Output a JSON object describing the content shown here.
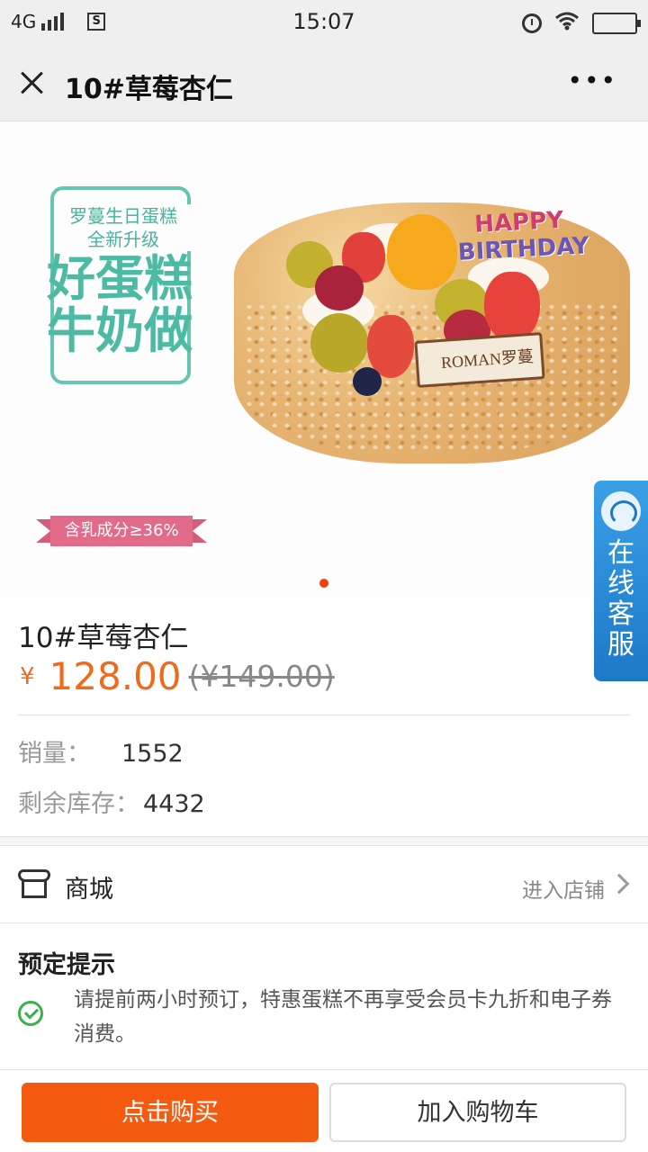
{
  "status_bar": {
    "network": "4G",
    "time": "15:07",
    "sim_icon": "sim-card-icon",
    "icons": [
      "signal-icon",
      "sim-card-icon",
      "alarm-icon",
      "wifi-icon",
      "battery-icon"
    ]
  },
  "nav": {
    "title": "10#草莓杏仁",
    "close_icon": "close-icon",
    "more_label": "•••"
  },
  "banner": {
    "promo_line1": "罗蔓生日蛋糕",
    "promo_line2": "全新升级",
    "promo_big1": "好蛋糕",
    "promo_big2": "牛奶做",
    "milk_ribbon": "含乳成分≥36%",
    "topper_line1": "HAPPY",
    "topper_line2": "BIRTHDAY",
    "plaque_text": "ROMAN罗蔓",
    "slide_count": 1,
    "active_slide": 0
  },
  "chat_float": {
    "label": "在线客服",
    "icon": "customer-service-icon"
  },
  "product": {
    "title": "10#草莓杏仁",
    "currency": "¥",
    "price": "128.00",
    "original_price": "(¥149.00)",
    "sales_label": "销量：",
    "sales_value": "1552",
    "stock_label": "剩余库存：",
    "stock_value": "4432"
  },
  "shop": {
    "label": "商城",
    "enter_label": "进入店铺",
    "icon": "shop-icon"
  },
  "tips": {
    "title": "预定提示",
    "text": "请提前两小时预订，特惠蛋糕不再享受会员卡九折和电子券消费。",
    "icon": "check-circle-icon"
  },
  "actions": {
    "buy_label": "点击购买",
    "cart_label": "加入购物车"
  },
  "colors": {
    "accent": "#f45a10",
    "price": "#f06a1b",
    "promo_green": "#4dbba3",
    "chat_blue": "#1d78c8",
    "check_green": "#38b24a"
  }
}
